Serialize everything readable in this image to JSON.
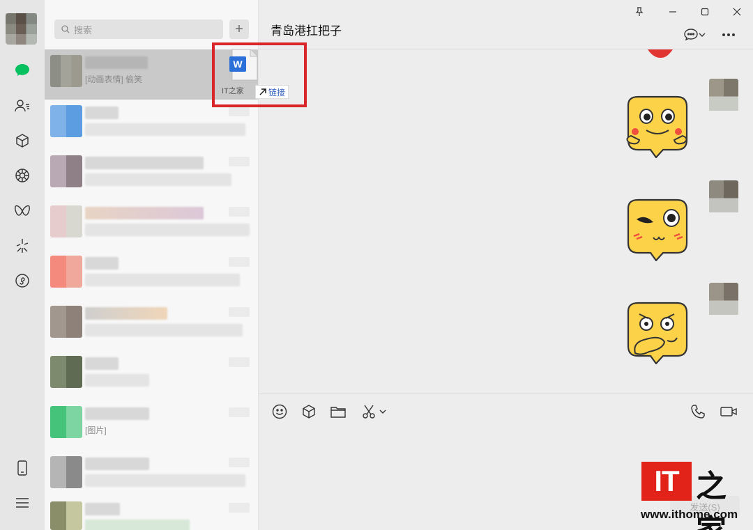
{
  "window": {
    "title": "青岛港扛把子"
  },
  "search": {
    "placeholder": "搜索",
    "add_label": "+"
  },
  "sidebar": {
    "icons": [
      "chat-icon",
      "contacts-icon",
      "favorites-icon",
      "moments-icon",
      "channels-icon",
      "search-discover-icon",
      "mini-program-icon",
      "phone-icon",
      "menu-icon"
    ]
  },
  "conversations": [
    {
      "preview": "[动画表情] 偷笑",
      "selected": true
    },
    {
      "preview": ""
    },
    {
      "preview": ""
    },
    {
      "preview": ""
    },
    {
      "preview": ""
    },
    {
      "preview": ""
    },
    {
      "preview": ""
    },
    {
      "preview": "[图片]"
    },
    {
      "preview": ""
    },
    {
      "preview": ""
    }
  ],
  "drag": {
    "file_name": "IT之家",
    "action_label": "链接",
    "file_badge": "W"
  },
  "input": {
    "send_label": "发送(S)"
  },
  "watermark": {
    "logo_text": "IT",
    "chinese": "之家",
    "url": "www.ithome.com"
  },
  "colors": {
    "accent_green": "#07c160",
    "highlight_red": "#d8262a",
    "link_blue": "#2a5bbd",
    "word_blue": "#2b6fd8"
  }
}
